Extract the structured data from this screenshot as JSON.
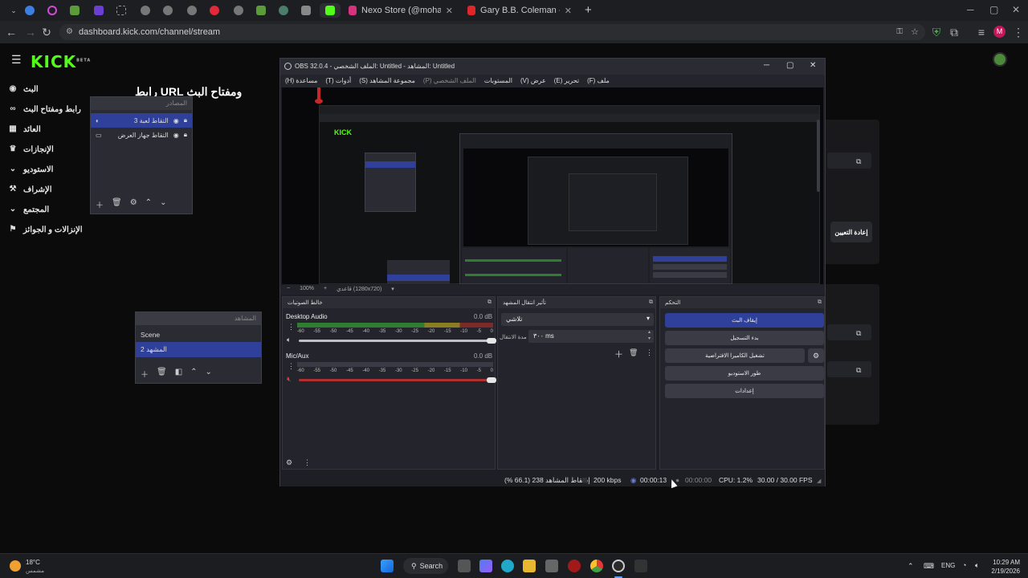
{
  "browser": {
    "tabs": [
      {
        "title": "Nexo Store (@mohamedltd202",
        "active": true
      },
      {
        "title": "Gary B.B. Coleman - The Sky is",
        "active": false
      }
    ],
    "new_tab": "+",
    "url": "dashboard.kick.com/channel/stream",
    "profile_initial": "M"
  },
  "kick": {
    "logo": "KICK",
    "logo_badge": "BETA",
    "page_heading": "ومفتاح البث URL رابط",
    "sidebar": [
      {
        "label": "البث",
        "icon": "broadcast-icon"
      },
      {
        "label": "رابط ومفتاح البث",
        "icon": "link-icon"
      },
      {
        "label": "العائد",
        "icon": "chart-icon"
      },
      {
        "label": "الإنجازات",
        "icon": "trophy-icon"
      },
      {
        "label": "الاستوديو",
        "icon": "chevron-down-icon"
      },
      {
        "label": "الإشراف",
        "icon": "hammer-icon"
      },
      {
        "label": "المجتمع",
        "icon": "chevron-down-icon"
      },
      {
        "label": "الإنزالات و الجوائز",
        "icon": "gift-icon"
      }
    ],
    "reset_button": "إعادة التعيين"
  },
  "sources_pane": {
    "header": "المصادر",
    "items": [
      {
        "label": "التقاط لعبة 3",
        "selected": true
      },
      {
        "label": "التقاط جهاز العرض",
        "selected": false
      }
    ]
  },
  "scenes_pane": {
    "header": "المشاهد",
    "items": [
      {
        "label": "Scene",
        "selected": false
      },
      {
        "label": "المشهد 2",
        "selected": true
      }
    ]
  },
  "obs": {
    "title": "OBS 32.0.4 - الملف الشخصي: Untitled - المشاهد: Untitled",
    "menu": [
      "ملف (F)",
      "تحرير (E)",
      "عرض (V)",
      "المستوبات",
      "الملف الشخصي (P)",
      "مجموعة المشاهد (S)",
      "أدوات (T)",
      "مساعدة (H)"
    ],
    "preview_zoom": "100%",
    "preview_resolution": "قاعدي (1280x720)",
    "mixer": {
      "header": "خالط الصوتيات",
      "channels": [
        {
          "name": "Desktop Audio",
          "db": "0.0 dB"
        },
        {
          "name": "Mic/Aux",
          "db": "0.0 dB"
        }
      ],
      "ticks": [
        "-60",
        "-55",
        "-50",
        "-45",
        "-40",
        "-35",
        "-30",
        "-25",
        "-20",
        "-15",
        "-10",
        "-5",
        "0"
      ]
    },
    "transitions": {
      "header": "تأثير انتقال المشهد",
      "selected": "تلاشي",
      "duration_label": "مدة الانتقال",
      "duration_value": "٣٠٠ ms"
    },
    "controls": {
      "header": "التحكم",
      "buttons": [
        "إيقاف البث",
        "بدء التسجيل",
        "تشغيل الكاميرا الافتراضية",
        "طور الاستوديو",
        "إعدادات"
      ]
    },
    "status": {
      "dropped": "إسقاط المشاهد 238 (66.1 %)",
      "bitrate": "200 kbps",
      "stream_time": "00:00:13",
      "rec_time": "00:00:00",
      "cpu": "CPU: 1.2%",
      "fps": "30.00 / 30.00 FPS"
    }
  },
  "taskbar": {
    "weather_temp": "18°C",
    "weather_desc": "مشمس",
    "search": "Search",
    "lang": "ENG",
    "time": "10:29 AM",
    "date": "2/19/2026"
  }
}
